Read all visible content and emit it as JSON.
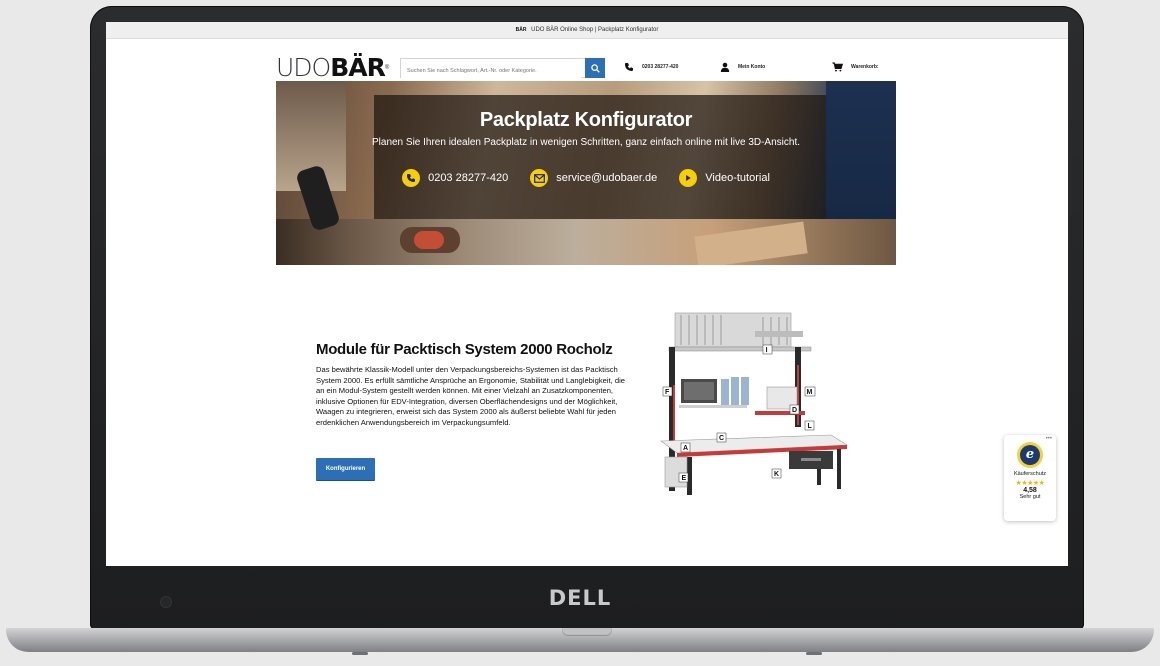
{
  "browser": {
    "favicon_text": "BÄR",
    "title": "UDO BÄR Online Shop | Packplatz Konfigurator"
  },
  "header": {
    "logo_part1": "UDO",
    "logo_part2": "BÄR",
    "logo_reg": "®",
    "search_placeholder": "Suchen Sie nach Schlagwort, Art.-Nr. oder Kategorie.",
    "phone": "0203 28277-420",
    "account": "Mein Konto",
    "cart": "Warenkorb:"
  },
  "hero": {
    "title": "Packplatz Konfigurator",
    "subtitle": "Planen Sie Ihren idealen Packplatz in wenigen Schritten, ganz einfach online mit live 3D-Ansicht.",
    "phone": "0203 28277-420",
    "email": "service@udobaer.de",
    "video": "Video-tutorial"
  },
  "content": {
    "title": "Module für Packtisch System 2000 Rocholz",
    "text": "Das bewährte Klassik-Modell unter den Verpackungsbereichs-Systemen ist das Packtisch System 2000. Es erfüllt sämtliche Ansprüche an Ergonomie, Stabilität und Langlebigkeit, die an ein Modul-System gestellt werden können. Mit einer Vielzahl an Zusatzkomponenten, inklusive Optionen für EDV-Integration, diversen Oberflächendesigns und der Möglichkeit, Waagen zu integrieren, erweist sich das System 2000 als äußerst beliebte Wahl für jeden erdenklichen Anwendungsbereich im Verpackungsumfeld.",
    "button": "Konfigurieren"
  },
  "product_labels": {
    "I": "I",
    "F": "F",
    "M": "M",
    "D": "D",
    "L": "L",
    "C": "C",
    "A": "A",
    "K": "K",
    "E": "E"
  },
  "trust_badge": {
    "label": "Käuferschutz",
    "stars": "★★★★★",
    "score": "4,58",
    "rating": "Sehr gut"
  },
  "device": {
    "brand": "DELL"
  },
  "colors": {
    "accent": "#2d6fb6",
    "hero_icon": "#f4cf0a",
    "frame": "#232426"
  }
}
